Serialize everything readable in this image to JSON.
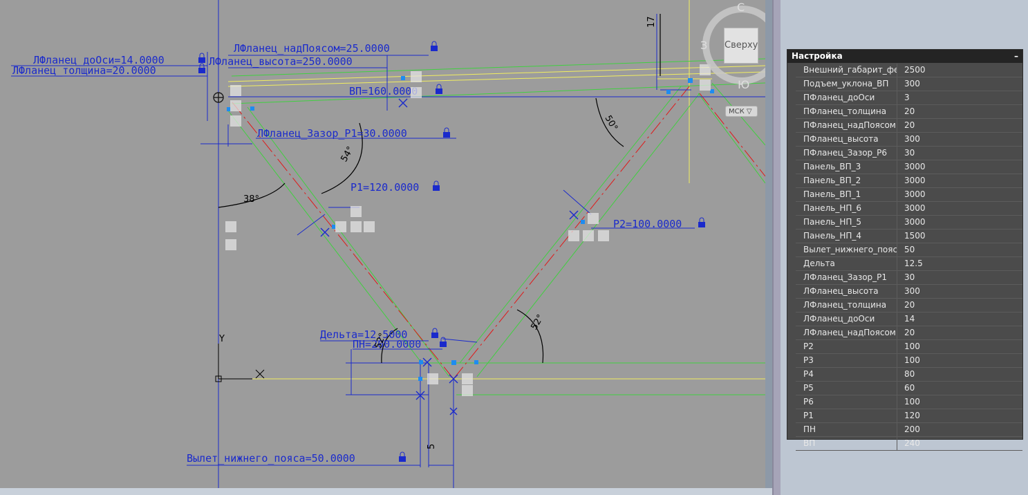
{
  "panel": {
    "title": "Настройка",
    "collapse_symbol": "–",
    "rows": [
      {
        "name": "Внешний_габарит_фер...",
        "value": "2500"
      },
      {
        "name": "Подъем_уклона_ВП",
        "value": "300"
      },
      {
        "name": "ПФланец_доОси",
        "value": "3"
      },
      {
        "name": "ПФланец_толщина",
        "value": "20"
      },
      {
        "name": "ПФланец_надПоясом",
        "value": "20"
      },
      {
        "name": "ПФланец_высота",
        "value": "300"
      },
      {
        "name": "ПФланец_Зазор_Р6",
        "value": "30"
      },
      {
        "name": "Панель_ВП_3",
        "value": "3000"
      },
      {
        "name": "Панель_ВП_2",
        "value": "3000"
      },
      {
        "name": "Панель_ВП_1",
        "value": "3000"
      },
      {
        "name": "Панель_НП_6",
        "value": "3000"
      },
      {
        "name": "Панель_НП_5",
        "value": "3000"
      },
      {
        "name": "Панель_НП_4",
        "value": "1500"
      },
      {
        "name": "Вылет_нижнего_пояса",
        "value": "50"
      },
      {
        "name": "Дельта",
        "value": "12.5"
      },
      {
        "name": "ЛФланец_Зазор_Р1",
        "value": "30"
      },
      {
        "name": "ЛФланец_высота",
        "value": "300"
      },
      {
        "name": "ЛФланец_толщина",
        "value": "20"
      },
      {
        "name": "ЛФланец_доОси",
        "value": "14"
      },
      {
        "name": "ЛФланец_надПоясом",
        "value": "20"
      },
      {
        "name": "Р2",
        "value": "100"
      },
      {
        "name": "Р3",
        "value": "100"
      },
      {
        "name": "Р4",
        "value": "80"
      },
      {
        "name": "Р5",
        "value": "60"
      },
      {
        "name": "Р6",
        "value": "100"
      },
      {
        "name": "Р1",
        "value": "120"
      },
      {
        "name": "ПН",
        "value": "200"
      },
      {
        "name": "ВП",
        "value": "240"
      }
    ]
  },
  "viewcube": {
    "top_label": "Сверху",
    "north": "С",
    "west": "З",
    "south": "Ю",
    "ucs_label": "МСК"
  },
  "drawing": {
    "dims": {
      "lflanec_doosi": "ЛФланец_доОси=14.0000",
      "lflanec_tolshina": "ЛФланец_толщина=20.0000",
      "lflanec_nadpoyasom": "ЛФланец_надПоясом=25.0000",
      "lflanec_vysota": "ЛФланец_высота=250.0000",
      "vp": "ВП=160.0000",
      "lflanec_zazor": "ЛФланец_Зазор_Р1=30.0000",
      "p1": "Р1=120.0000",
      "p2": "Р2=100.0000",
      "delta": "Дельта=12.5000",
      "pn": "ПН=200.0000",
      "vylet": "Вылет_нижнего_пояса=50.0000"
    },
    "angles": {
      "a54": "54°",
      "a38": "38°",
      "a50": "50°",
      "a52": "52°",
      "a52b": "52°"
    },
    "small_dims": {
      "d17": "17",
      "d5": "5"
    },
    "axis": {
      "y": "Y"
    }
  }
}
